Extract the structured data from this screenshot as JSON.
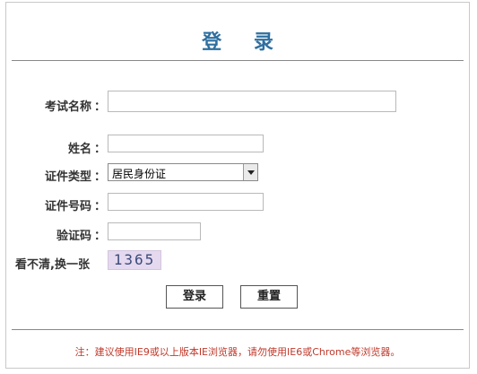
{
  "header": {
    "title": "登 录"
  },
  "form": {
    "exam_name_label": "考试名称",
    "name_label": "姓名",
    "id_type_label": "证件类型",
    "id_type_value": "居民身份证",
    "id_number_label": "证件号码",
    "captcha_label": "验证码",
    "colon": "：",
    "refresh_captcha_label": "看不清,换一张",
    "captcha_text": "1365"
  },
  "buttons": {
    "login": "登录",
    "reset": "重置"
  },
  "note": "注：建议使用IE9或以上版本IE浏览器，请勿使用IE6或Chrome等浏览器。",
  "colors": {
    "title": "#2e6fa0",
    "note": "#c0392b"
  }
}
